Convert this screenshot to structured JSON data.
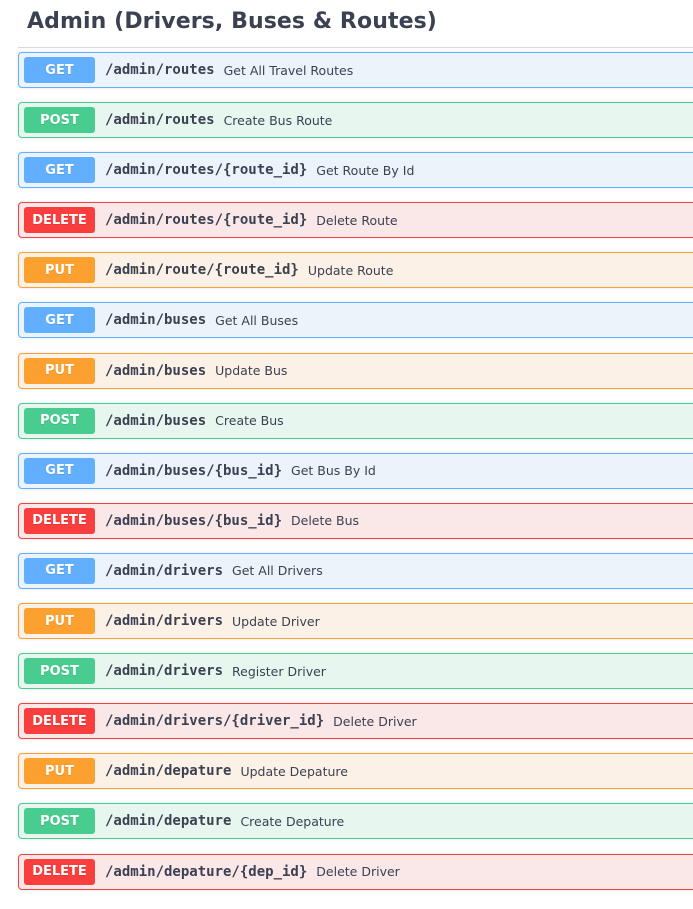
{
  "section": {
    "title": "Admin (Drivers, Buses & Routes)"
  },
  "colors": {
    "get": "#61affe",
    "post": "#49cc90",
    "put": "#fca130",
    "delete": "#f93e3e",
    "text": "#3b4151"
  },
  "operations": [
    {
      "method": "GET",
      "path": "/admin/routes",
      "summary": "Get All Travel Routes"
    },
    {
      "method": "POST",
      "path": "/admin/routes",
      "summary": "Create Bus Route"
    },
    {
      "method": "GET",
      "path": "/admin/routes/{route_id}",
      "summary": "Get Route By Id"
    },
    {
      "method": "DELETE",
      "path": "/admin/routes/{route_id}",
      "summary": "Delete Route"
    },
    {
      "method": "PUT",
      "path": "/admin/route/{route_id}",
      "summary": "Update Route"
    },
    {
      "method": "GET",
      "path": "/admin/buses",
      "summary": "Get All Buses"
    },
    {
      "method": "PUT",
      "path": "/admin/buses",
      "summary": "Update Bus"
    },
    {
      "method": "POST",
      "path": "/admin/buses",
      "summary": "Create Bus"
    },
    {
      "method": "GET",
      "path": "/admin/buses/{bus_id}",
      "summary": "Get Bus By Id"
    },
    {
      "method": "DELETE",
      "path": "/admin/buses/{bus_id}",
      "summary": "Delete Bus"
    },
    {
      "method": "GET",
      "path": "/admin/drivers",
      "summary": "Get All Drivers"
    },
    {
      "method": "PUT",
      "path": "/admin/drivers",
      "summary": "Update Driver"
    },
    {
      "method": "POST",
      "path": "/admin/drivers",
      "summary": "Register Driver"
    },
    {
      "method": "DELETE",
      "path": "/admin/drivers/{driver_id}",
      "summary": "Delete Driver"
    },
    {
      "method": "PUT",
      "path": "/admin/depature",
      "summary": "Update Depature"
    },
    {
      "method": "POST",
      "path": "/admin/depature",
      "summary": "Create Depature"
    },
    {
      "method": "DELETE",
      "path": "/admin/depature/{dep_id}",
      "summary": "Delete Driver"
    }
  ]
}
